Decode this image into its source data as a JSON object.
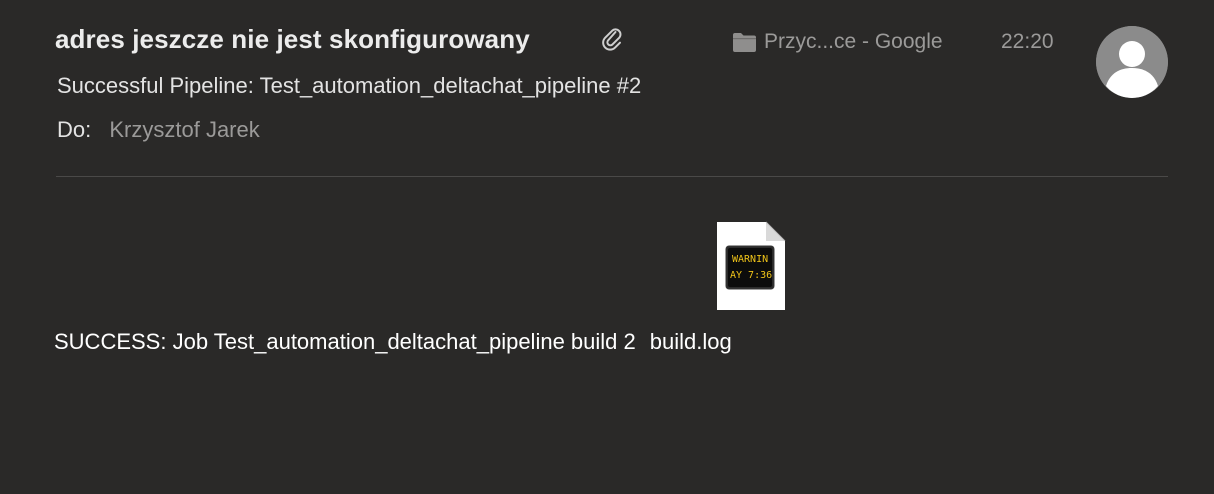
{
  "message": {
    "sender": "adres jeszcze nie jest skonfigurowany",
    "attachment_indicator_icon": "paperclip-icon",
    "mailbox_icon": "folder-icon",
    "mailbox": "Przyc...ce - Google",
    "time": "22:20",
    "avatar_icon": "person-silhouette-icon",
    "subject": "Successful Pipeline: Test_automation_deltachat_pipeline #2",
    "to_label": "Do:",
    "to_name": "Krzysztof Jarek"
  },
  "body": {
    "text": "SUCCESS: Job Test_automation_deltachat_pipeline build 2",
    "attachment": {
      "name": "build.log",
      "icon": "log-file-icon",
      "preview_line1": "WARNIN",
      "preview_line2": "AY 7:36"
    }
  },
  "colors": {
    "background": "#2a2928",
    "primary_text": "#e6e6e6",
    "secondary_text": "#9b9a99",
    "log_text": "#f0c419"
  }
}
